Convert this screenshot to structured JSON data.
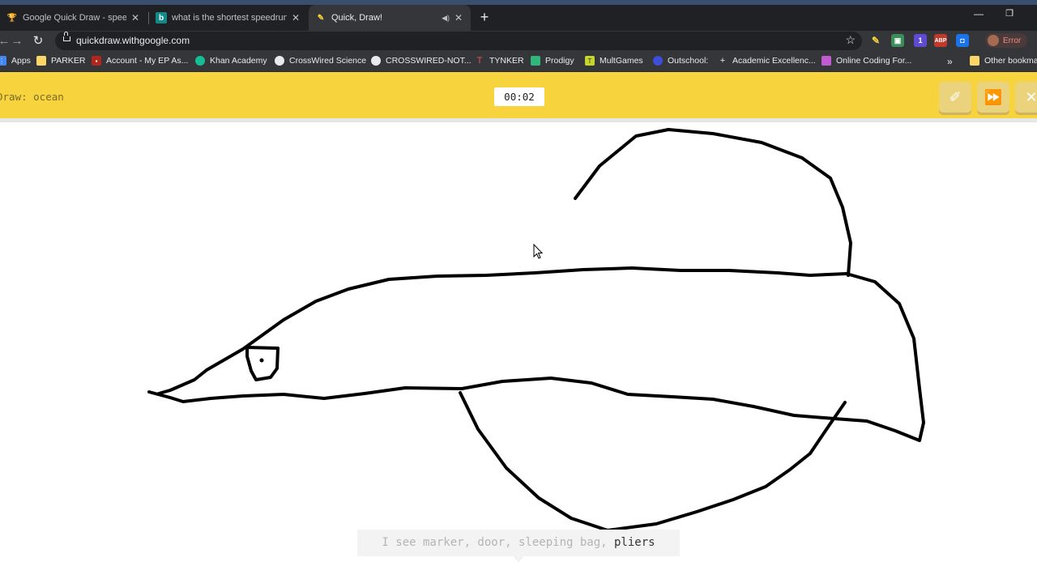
{
  "browser": {
    "tabs": [
      {
        "title": "Google Quick Draw - speedrun.co",
        "favicon": "speedrun-trophy-icon"
      },
      {
        "title": "what is the shortest speedrun - B",
        "favicon": "bing-icon"
      },
      {
        "title": "Quick, Draw!",
        "favicon": "quickdraw-icon",
        "active": true,
        "audio": true
      }
    ],
    "url": "quickdraw.withgoogle.com",
    "profile_status": "Error",
    "bookmarks": [
      {
        "label": "Apps",
        "icon": "apps-grid-icon",
        "color": "#4285f4"
      },
      {
        "label": "PARKER",
        "icon": "folder-icon",
        "color": "#f9d667"
      },
      {
        "label": "Account - My EP As...",
        "icon": "account-icon",
        "color": "#b3261e"
      },
      {
        "label": "Khan Academy",
        "icon": "khan-academy-icon",
        "color": "#14bf96"
      },
      {
        "label": "CrossWired Science",
        "icon": "crosswired-icon",
        "color": "#e8eaed"
      },
      {
        "label": "CROSSWIRED-NOT...",
        "icon": "globe-icon",
        "color": "#e8eaed"
      },
      {
        "label": "TYNKER",
        "icon": "tynker-icon",
        "color": "#e8505b"
      },
      {
        "label": "Prodigy",
        "icon": "prodigy-icon",
        "color": "#2fb67a"
      },
      {
        "label": "MultGames",
        "icon": "multgames-icon",
        "color": "#c7d62b"
      },
      {
        "label": "Outschool:",
        "icon": "outschool-icon",
        "color": "#3b4fd8"
      },
      {
        "label": "Academic Excellenc...",
        "icon": "plus-icon",
        "color": "#e8eaed"
      },
      {
        "label": "Online Coding For...",
        "icon": "coding-icon",
        "color": "#c05ccf"
      }
    ],
    "other_bookmarks": "Other bookma"
  },
  "game": {
    "prompt": "Draw: ocean",
    "timer": "00:02",
    "guess_prefix": "I see marker, door, sleeping bag, ",
    "guess_last": "pliers",
    "header_color": "#f7d33d"
  }
}
